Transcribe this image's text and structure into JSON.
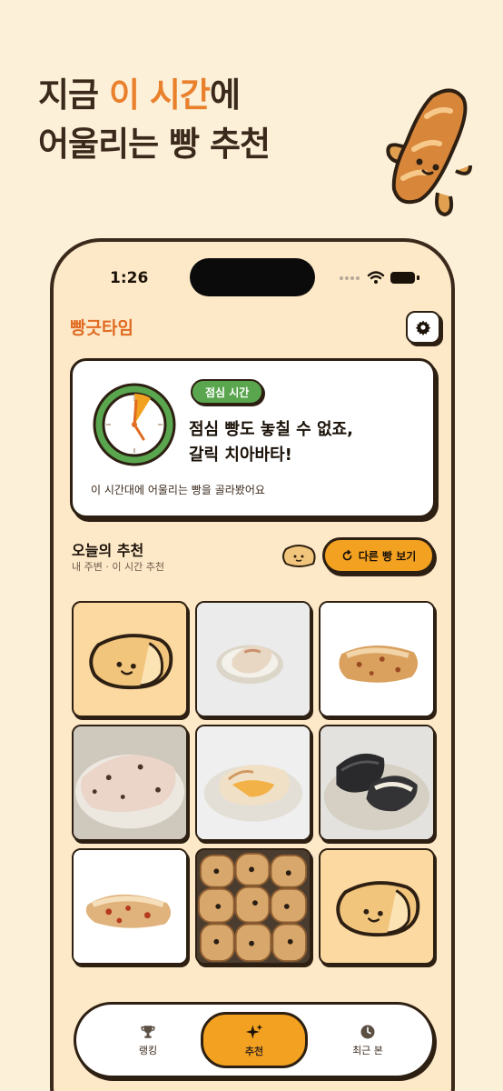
{
  "headline": {
    "line1_pre": "지금 ",
    "line1_accent": "이 시간",
    "line1_post": "에",
    "line2": "어울리는 빵 추천"
  },
  "status_bar": {
    "time": "1:26"
  },
  "app": {
    "name": "빵긋타임"
  },
  "hero": {
    "badge": "점심 시간",
    "title_line1": "점심 빵도 놓칠 수 없죠,",
    "title_line2": "갈릭 치아바타!",
    "description": "이 시간대에 어울리는 빵을 골라봤어요"
  },
  "section": {
    "title": "오늘의 추천",
    "subtitle": "내 주변 · 이 시간 추천",
    "refresh_label": "다른 빵 보기"
  },
  "grid": {
    "items": [
      "placeholder-bread",
      "ciabatta-on-plate",
      "ciabatta-loaf",
      "bread-on-plate",
      "garlic-ciabatta-on-plate",
      "black-ciabatta-on-plate",
      "tomato-ciabatta",
      "pull-apart-rolls",
      "placeholder-bread"
    ]
  },
  "tabs": [
    {
      "label": "랭킹",
      "icon": "trophy-icon"
    },
    {
      "label": "추천",
      "icon": "sparkle-icon",
      "active": true
    },
    {
      "label": "최근 본",
      "icon": "clock-icon"
    }
  ],
  "colors": {
    "background": "#fdf0d9",
    "accent": "#e8802c",
    "primary": "#f3a120",
    "badge": "#5aa64f",
    "outline": "#2d1f12"
  }
}
